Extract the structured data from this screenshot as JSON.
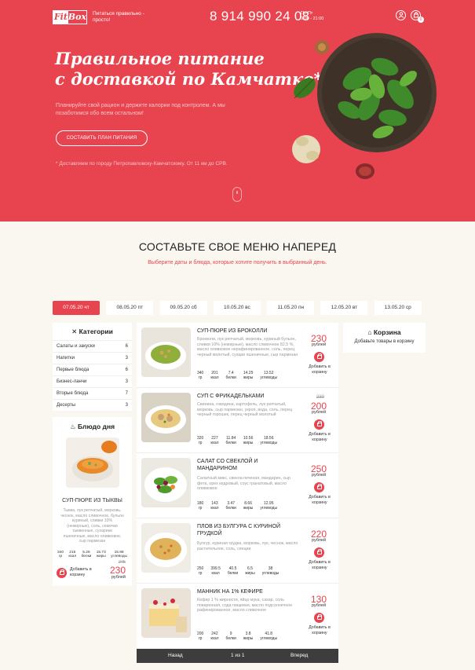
{
  "header": {
    "logo_left": "Fit",
    "logo_right": "Box",
    "tagline": "Питаться правильно - просто!",
    "phone": "8 914 990 24 08",
    "hours_days": "Пн-Пт",
    "hours_time": "9:00 - 21:00",
    "cart_count": "0"
  },
  "hero": {
    "title_line1": "Правильное питание",
    "title_line2": "с доставкой по Камчатке*",
    "subtitle": "Планируйте свой рацион и держите калории под контролем. А мы позаботимся обо всем остальном!",
    "button": "Составить план питания",
    "note": "* Доставляем по городу Петропавловску-Камчатскому. От 11 км до СРВ."
  },
  "section": {
    "title": "СОСТАВЬТЕ СВОЕ МЕНЮ НАПЕРЕД",
    "subtitle": "Выберите даты и блюда, которые хотите получить в выбранный день."
  },
  "dates": [
    "07.05.20 чт",
    "08.05.20 пт",
    "09.05.20 сб",
    "10.05.20 вс",
    "11.05.20 пн",
    "12.05.20 вт",
    "13.05.20 ср"
  ],
  "categories": {
    "title": "Категории",
    "items": [
      {
        "label": "Салаты и закуски",
        "count": "6"
      },
      {
        "label": "Напитки",
        "count": "3"
      },
      {
        "label": "Первые блюда",
        "count": "6"
      },
      {
        "label": "Бизнес-ланчи",
        "count": "3"
      },
      {
        "label": "Вторые блюда",
        "count": "7"
      },
      {
        "label": "Десерты",
        "count": "3"
      }
    ]
  },
  "dish_of_day": {
    "title": "Блюдо дня",
    "name": "СУП-ПЮРЕ ИЗ ТЫКВЫ",
    "desc": "Тыква, лук репчатый, морковь, чеснок, масло сливочное, бульон куриный, сливки 10% (нежирные), соль, семечки тыквенные, сухарики пшеничные, масло оливковое, сыр пармезан",
    "nutrition": [
      {
        "v": "340",
        "u": "гр"
      },
      {
        "v": "215",
        "u": "ккал"
      },
      {
        "v": "5.26",
        "u": "белки"
      },
      {
        "v": "15.73",
        "u": "жиры"
      },
      {
        "v": "15.98",
        "u": "углеводы"
      }
    ],
    "add_label": "Добавить в корзину",
    "old_price": "245",
    "price": "230",
    "price_unit": "рублей"
  },
  "menu": [
    {
      "name": "СУП-ПЮРЕ ИЗ БРОКОЛЛИ",
      "desc": "Брокколи, лук репчатый, морковь, куриный бульон, сливки 10% (нежирные), масло сливочное 82,5 %, масло оливковое нерафинированное, соль, перец черный молотый, сухари пшеничные, сыр пармезан",
      "nutrition": [
        {
          "v": "340",
          "u": "гр"
        },
        {
          "v": "201",
          "u": "ккал"
        },
        {
          "v": "7.4",
          "u": "белки"
        },
        {
          "v": "14.25",
          "u": "жиры"
        },
        {
          "v": "13.52",
          "u": "углеводы"
        }
      ],
      "old_price": "",
      "price": "230",
      "price_unit": "рублей",
      "add_label": "Добавить в корзину"
    },
    {
      "name": "СУП С ФРИКАДЕЛЬКАМИ",
      "desc": "Свинина, говядина, картофель, лук репчатый, морковь, сыр пармезан, укроп, вода, соль, перец черный горошек, перец черный молотый",
      "nutrition": [
        {
          "v": "320",
          "u": "гр"
        },
        {
          "v": "227",
          "u": "ккал"
        },
        {
          "v": "11.84",
          "u": "белки"
        },
        {
          "v": "10.56",
          "u": "жиры"
        },
        {
          "v": "18.56",
          "u": "углеводы"
        }
      ],
      "old_price": "230",
      "price": "200",
      "price_unit": "рублей",
      "add_label": "Добавить в корзину"
    },
    {
      "name": "САЛАТ СО СВЕКЛОЙ И МАНДАРИНОМ",
      "desc": "Салатный микс, свекла печеная, мандарин, сыр фета, орех кедровый, соус гранатовый, масло оливковое",
      "nutrition": [
        {
          "v": "180",
          "u": "гр"
        },
        {
          "v": "143",
          "u": "ккал"
        },
        {
          "v": "3.47",
          "u": "белки"
        },
        {
          "v": "8.66",
          "u": "жиры"
        },
        {
          "v": "12.95",
          "u": "углеводы"
        }
      ],
      "old_price": "",
      "price": "250",
      "price_unit": "рублей",
      "add_label": "Добавить в корзину"
    },
    {
      "name": "ПЛОВ ИЗ БУЛГУРА С КУРИНОЙ ГРУДКОЙ",
      "desc": "Булгур, куриная грудка, морковь, лук, чеснок, масло растительное, соль, специи",
      "nutrition": [
        {
          "v": "250",
          "u": "гр"
        },
        {
          "v": "399.5",
          "u": "ккал"
        },
        {
          "v": "40.5",
          "u": "белки"
        },
        {
          "v": "6.5",
          "u": "жиры"
        },
        {
          "v": "38",
          "u": "углеводы"
        }
      ],
      "old_price": "",
      "price": "220",
      "price_unit": "рублей",
      "add_label": "Добавить в корзину"
    },
    {
      "name": "МАННИК НА 1% КЕФИРЕ",
      "desc": "Кефир 1 % жирности, яйцо мука, сахар, соль поваренная, сода пищевая, масло подсолнечное рафинированное, масло сливочное",
      "nutrition": [
        {
          "v": "200",
          "u": "гр"
        },
        {
          "v": "242",
          "u": "ккал"
        },
        {
          "v": "9",
          "u": "белки"
        },
        {
          "v": "3.8",
          "u": "жиры"
        },
        {
          "v": "41.8",
          "u": "углеводы"
        }
      ],
      "old_price": "",
      "price": "130",
      "price_unit": "рублей",
      "add_label": "Добавить в корзину"
    }
  ],
  "pager": {
    "prev": "Назад",
    "page": "1 из 1",
    "next": "Вперед"
  },
  "cart": {
    "title": "Корзина",
    "empty": "Добавьте товары в корзину"
  },
  "colors": {
    "accent": "#e8444f",
    "background": "#faf7f0",
    "pager": "#3d3d3d"
  }
}
